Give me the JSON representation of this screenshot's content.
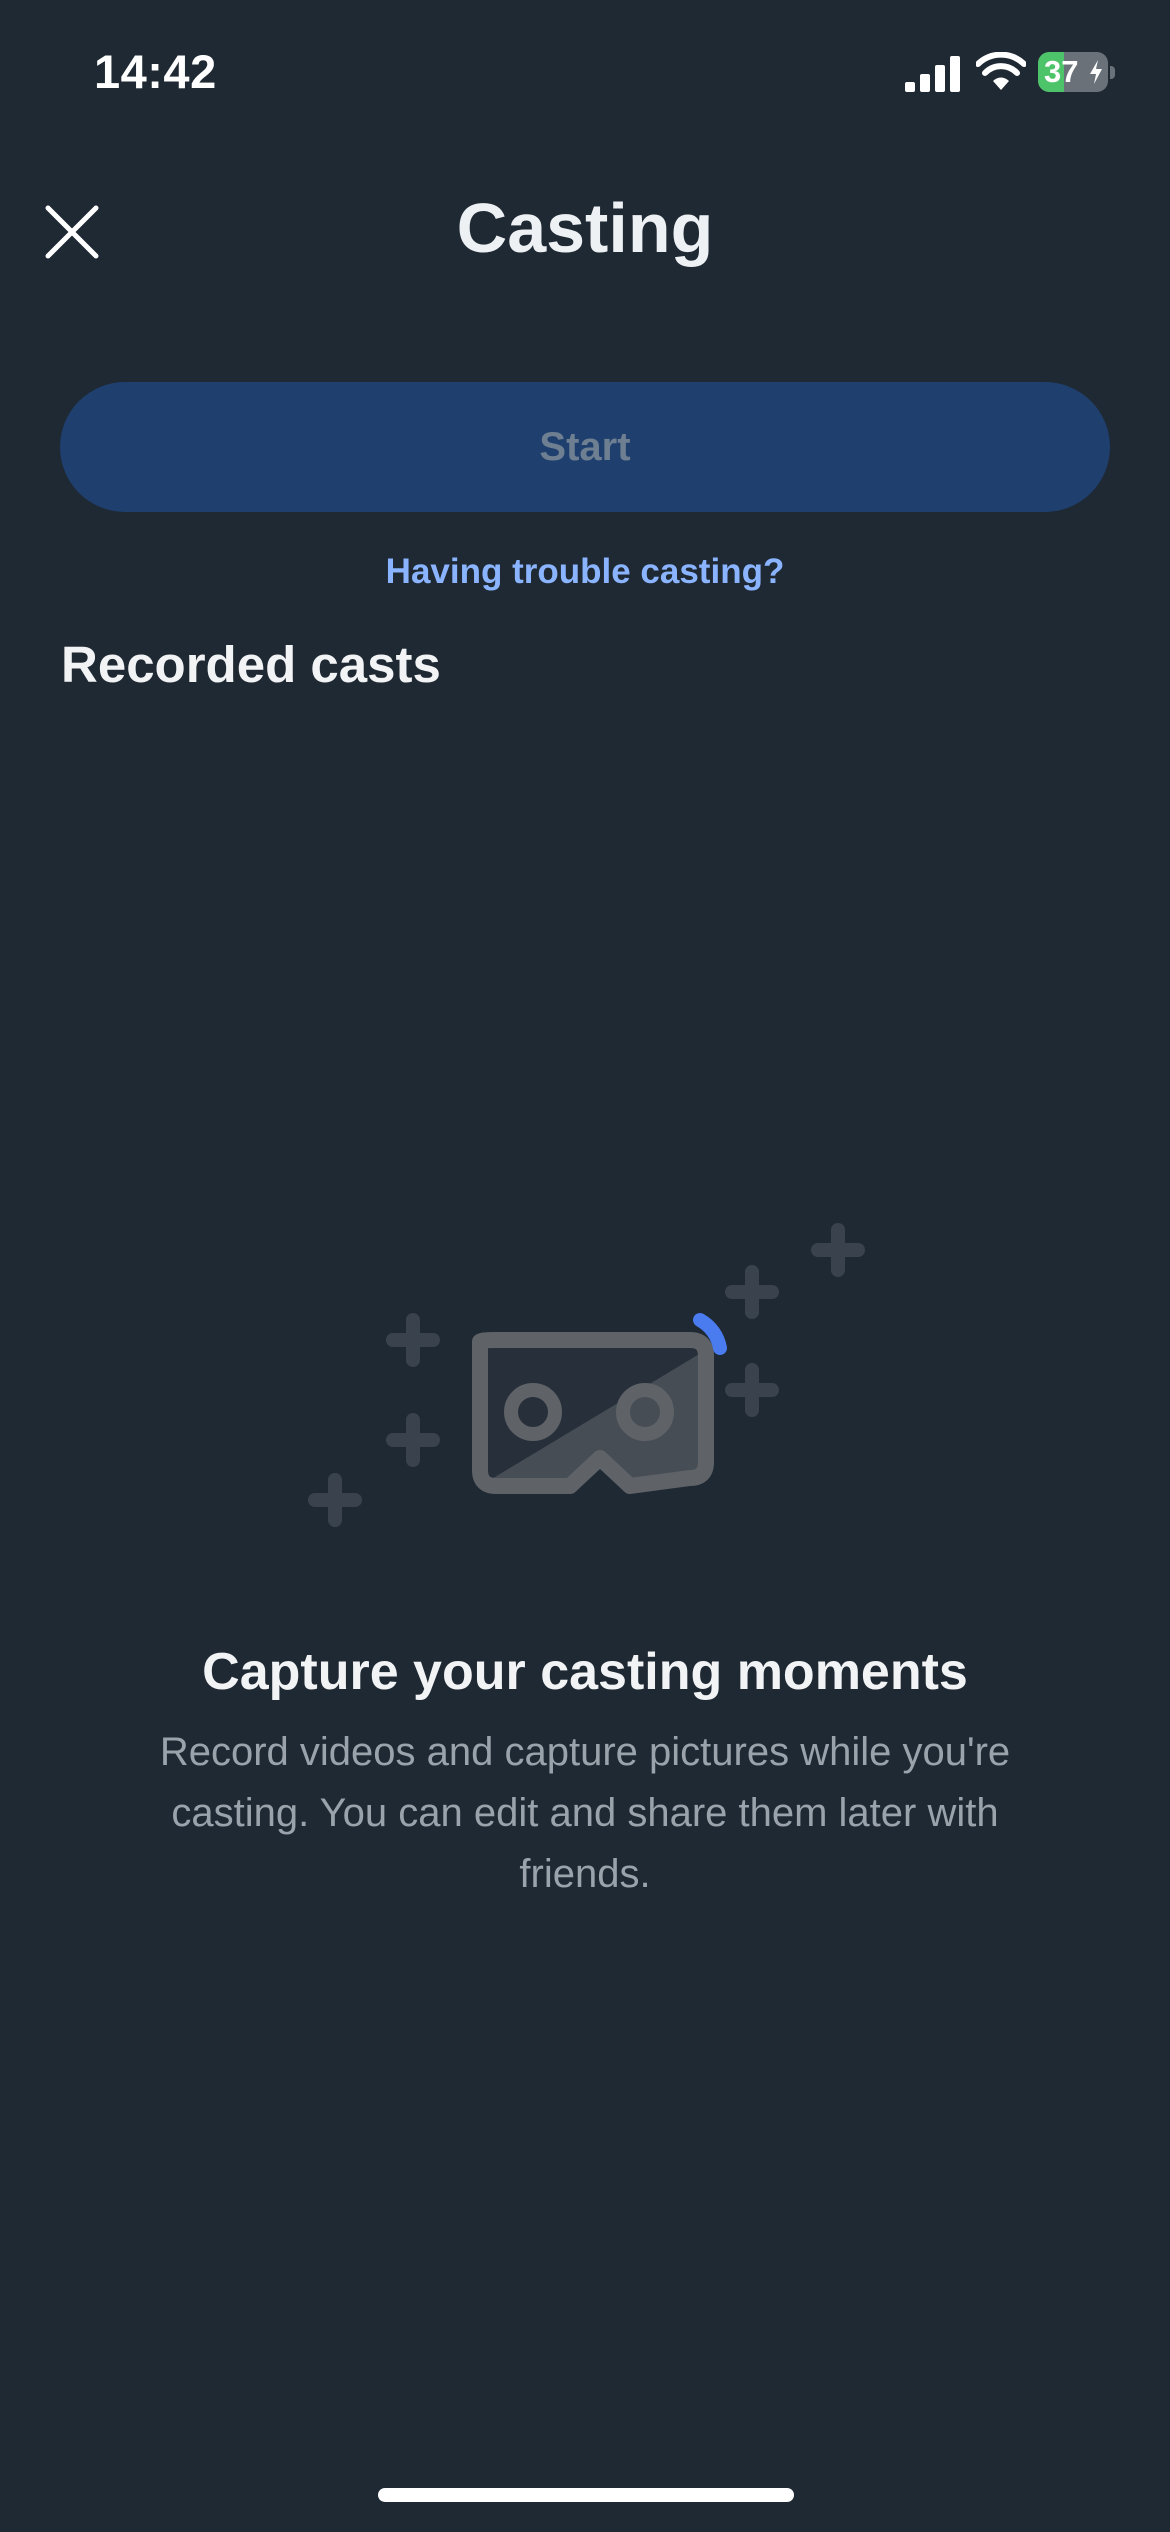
{
  "status_bar": {
    "time": "14:42",
    "battery_level": "37",
    "battery_fraction": 0.37,
    "icons": [
      "signal-icon",
      "wifi-icon",
      "battery-icon",
      "charging-bolt-icon"
    ]
  },
  "header": {
    "title": "Casting",
    "close_icon": "close-icon"
  },
  "actions": {
    "start_label": "Start",
    "trouble_link": "Having trouble casting?"
  },
  "recorded_casts": {
    "heading": "Recorded casts",
    "empty_state": {
      "illustration_icon": "vr-headset-icon",
      "title": "Capture your casting moments",
      "description": "Record videos and capture pictures while you're casting. You can edit and share them later with friends."
    }
  },
  "colors": {
    "background": "#1f2933",
    "start_button": "#1f3f6e",
    "link": "#8ab4ff",
    "accent_spinner": "#4a7cf0",
    "battery_green": "#4ec46a"
  }
}
